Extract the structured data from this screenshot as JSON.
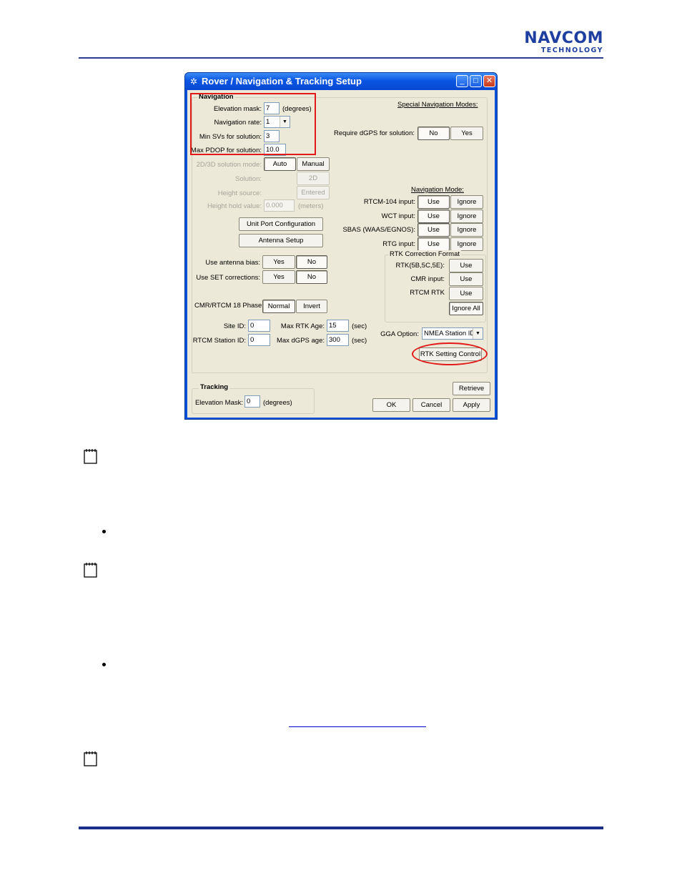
{
  "header": {
    "logo_main": "NAVCOM",
    "logo_sub": "TECHNOLOGY"
  },
  "window": {
    "title": "Rover / Navigation & Tracking Setup",
    "icon": "satellite-icon",
    "controls": [
      "minimize-icon",
      "maximize-icon",
      "close-icon"
    ]
  },
  "navigation": {
    "group_title": "Navigation",
    "elevation_mask_label": "Elevation mask:",
    "elevation_mask_value": "7",
    "elevation_mask_unit": "(degrees)",
    "navigation_rate_label": "Navigation rate:",
    "navigation_rate_value": "1",
    "min_svs_label": "Min SVs for solution:",
    "min_svs_value": "3",
    "max_pdop_label": "Max PDOP for solution:",
    "max_pdop_value": "10.0",
    "solution_mode_label": "2D/3D solution mode:",
    "solution_mode_auto": "Auto",
    "solution_mode_manual": "Manual",
    "solution_label": "Solution:",
    "solution_value": "2D",
    "height_source_label": "Height source:",
    "height_source_value": "Entered",
    "height_hold_label": "Height hold value:",
    "height_hold_value": "0.000",
    "height_hold_unit": "(meters)",
    "unit_port_button": "Unit Port Configuration",
    "antenna_setup_button": "Antenna Setup",
    "antenna_bias_label": "Use antenna bias:",
    "set_corrections_label": "Use SET corrections:",
    "yes": "Yes",
    "no": "No",
    "cmr_phase_label": "CMR/RTCM 18 Phase:",
    "cmr_phase_normal": "Normal",
    "cmr_phase_invert": "Invert",
    "site_id_label": "Site ID:",
    "site_id_value": "0",
    "rtcm_station_label": "RTCM Station ID:",
    "rtcm_station_value": "0",
    "max_rtk_age_label": "Max RTK Age:",
    "max_rtk_age_value": "15",
    "max_dgps_age_label": "Max dGPS age:",
    "max_dgps_age_value": "300",
    "sec_unit": "(sec)"
  },
  "special_modes": {
    "title": "Special Navigation Modes:",
    "require_dgps_label": "Require dGPS for solution:",
    "no": "No",
    "yes": "Yes"
  },
  "navigation_mode": {
    "title": "Navigation Mode:",
    "rows": [
      {
        "label": "RTCM-104 input:",
        "use": "Use",
        "ignore": "Ignore"
      },
      {
        "label": "WCT input:",
        "use": "Use",
        "ignore": "Ignore"
      },
      {
        "label": "SBAS (WAAS/EGNOS):",
        "use": "Use",
        "ignore": "Ignore"
      },
      {
        "label": "RTG input:",
        "use": "Use",
        "ignore": "Ignore"
      }
    ]
  },
  "rtk_format": {
    "title": "RTK Correction Format",
    "rows": [
      {
        "label": "RTK(5B,5C,5E):",
        "use": "Use"
      },
      {
        "label": "CMR input:",
        "use": "Use"
      },
      {
        "label": "RTCM RTK",
        "use": "Use"
      }
    ],
    "ignore_all": "Ignore All"
  },
  "gga": {
    "label": "GGA Option:",
    "value": "NMEA Station ID"
  },
  "rtk_setting_button": "RTK Setting Control",
  "tracking": {
    "group_title": "Tracking",
    "elevation_label": "Elevation Mask:",
    "elevation_value": "0",
    "elevation_unit": "(degrees)"
  },
  "buttons": {
    "retrieve": "Retrieve",
    "ok": "OK",
    "cancel": "Cancel",
    "apply": "Apply"
  },
  "colors": {
    "highlight": "#e31a1a",
    "brand": "#1f3fa0",
    "titlebar": "#0a55e3"
  }
}
